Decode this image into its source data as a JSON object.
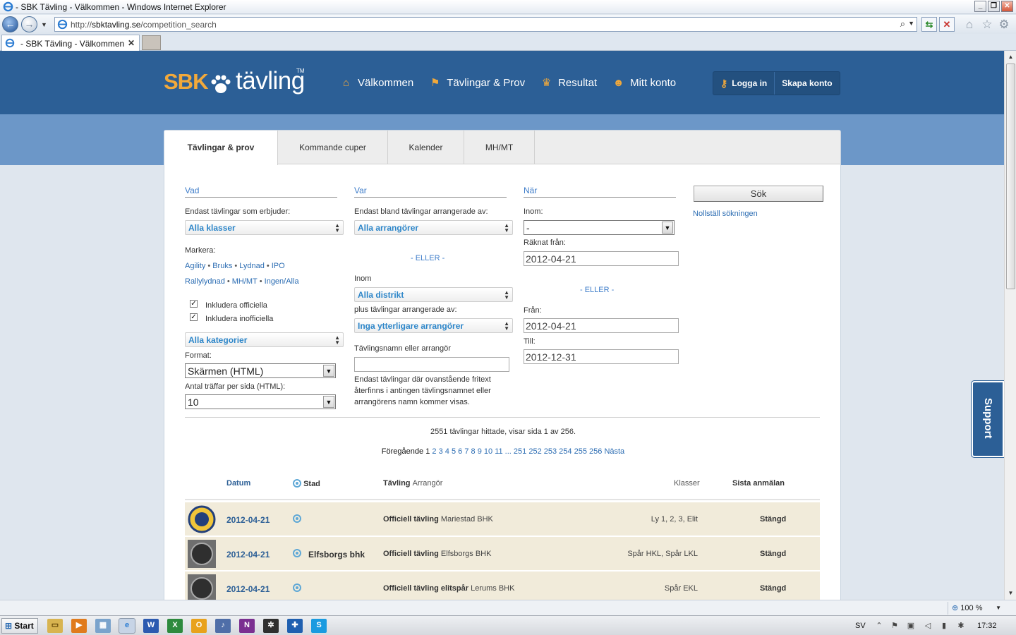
{
  "window": {
    "title": "- SBK Tävling - Välkommen - Windows Internet Explorer",
    "controls": [
      "_",
      "❐",
      "✕"
    ]
  },
  "address": {
    "url_prefix": "http://",
    "url_host": "sbktavling.se",
    "url_path": "/competition_search"
  },
  "browser_tab": {
    "label": "- SBK Tävling - Välkommen",
    "close": "✕"
  },
  "site": {
    "logo_sbk": "SBK",
    "logo_tavling": "tävling",
    "logo_tm": "TM",
    "nav": [
      {
        "label": "Välkommen",
        "icon": "home-icon"
      },
      {
        "label": "Tävlingar & Prov",
        "icon": "flag-icon"
      },
      {
        "label": "Resultat",
        "icon": "trophy-icon"
      },
      {
        "label": "Mitt konto",
        "icon": "user-icon"
      }
    ],
    "login": "Logga in",
    "register": "Skapa konto"
  },
  "tabs": [
    "Tävlingar & prov",
    "Kommande cuper",
    "Kalender",
    "MH/MT"
  ],
  "form": {
    "vad": {
      "heading": "Vad",
      "classes_label": "Endast tävlingar som erbjuder:",
      "classes_value": "Alla klasser",
      "mark_label": "Markera:",
      "mark_links_1": [
        "Agility",
        "Bruks",
        "Lydnad",
        "IPO"
      ],
      "mark_links_2": [
        "Rallylydnad",
        "MH/MT",
        "Ingen/Alla"
      ],
      "include_official": "Inkludera officiella",
      "include_unofficial": "Inkludera inofficiella",
      "category_value": "Alla kategorier",
      "format_label": "Format:",
      "format_value": "Skärmen (HTML)",
      "per_page_label": "Antal träffar per sida (HTML):",
      "per_page_value": "10"
    },
    "var": {
      "heading": "Var",
      "organizer_label": "Endast bland tävlingar arrangerade av:",
      "organizer_value": "Alla arrangörer",
      "or": "- ELLER -",
      "within_label": "Inom",
      "district_value": "Alla distrikt",
      "plus_label": "plus tävlingar arrangerade av:",
      "plus_value": "Inga ytterligare arrangörer",
      "name_label": "Tävlingsnamn eller arrangör",
      "name_value": "",
      "note": "Endast tävlingar där ovanstående fritext återfinns i antingen tävlingsnamnet eller arrangörens namn kommer visas."
    },
    "nar": {
      "heading": "När",
      "within_label": "Inom:",
      "within_value": "-",
      "counted_from_label": "Räknat från:",
      "counted_from_value": "2012-04-21",
      "or": "- ELLER -",
      "from_label": "Från:",
      "from_value": "2012-04-21",
      "to_label": "Till:",
      "to_value": "2012-12-31"
    },
    "search_button": "Sök",
    "reset_link": "Nollställ sökningen"
  },
  "results": {
    "summary": "2551 tävlingar hittade, visar sida 1 av 256.",
    "prev": "Föregående",
    "current_page": "1",
    "pages": [
      "2",
      "3",
      "4",
      "5",
      "6",
      "7",
      "8",
      "9",
      "10",
      "11"
    ],
    "ellipsis": "...",
    "tail_pages": [
      "251",
      "252",
      "253",
      "254",
      "255",
      "256"
    ],
    "next": "Nästa",
    "columns": {
      "date": "Datum",
      "city": "Stad",
      "competition": "Tävling",
      "organizer": "Arrangör",
      "classes": "Klasser",
      "deadline": "Sista anmälan"
    },
    "rows": [
      {
        "date": "2012-04-21",
        "city": "",
        "type": "Officiell tävling",
        "organizer": "Mariestad BHK",
        "classes": "Ly 1, 2, 3, Elit",
        "deadline": "Stängd",
        "logo": "club-logo-yellow"
      },
      {
        "date": "2012-04-21",
        "city": "Elfsborgs bhk",
        "type": "Officiell tävling",
        "organizer": "Elfsborgs BHK",
        "classes": "Spår HKL, Spår LKL",
        "deadline": "Stängd",
        "logo": "club-logo-gray"
      },
      {
        "date": "2012-04-21",
        "city": "",
        "type": "Officiell tävling elitspår",
        "organizer": "Lerums BHK",
        "classes": "Spår EKL",
        "deadline": "Stängd",
        "logo": "club-logo-gray"
      }
    ]
  },
  "support": "Support",
  "statusbar": {
    "zoom": "100 %"
  },
  "taskbar": {
    "start": "Start",
    "lang": "SV",
    "clock": "17:32"
  }
}
